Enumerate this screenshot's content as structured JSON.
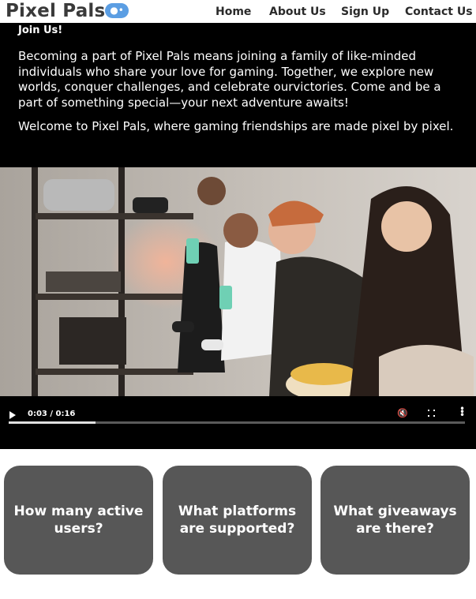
{
  "header": {
    "logo_text": "Pixel Pals",
    "logo_icon": "gamepad-icon",
    "nav": [
      "Home",
      "About Us",
      "Sign Up",
      "Contact Us"
    ]
  },
  "join": {
    "title": "Join Us!",
    "paragraph1": "Becoming a part of Pixel Pals means joining a family of like-minded individuals who share your love for gaming. Together, we explore new worlds, conquer challenges, and celebrate ourvictories. Come and be a part of something special—your next adventure awaits!",
    "paragraph2": "Welcome to Pixel Pals, where gaming friendships are made pixel by pixel."
  },
  "video": {
    "time": "0:03 / 0:16",
    "progress": 0.19,
    "icons": [
      "play-icon",
      "mute-icon",
      "fullscreen-icon",
      "more-options-icon"
    ]
  },
  "faq": [
    "How many active users?",
    "What platforms are supported?",
    "What giveaways are there?"
  ],
  "colors": {
    "join_bg": "#000000",
    "card_bg": "#575757",
    "logo_icon_bg": "#5b9ee3"
  }
}
